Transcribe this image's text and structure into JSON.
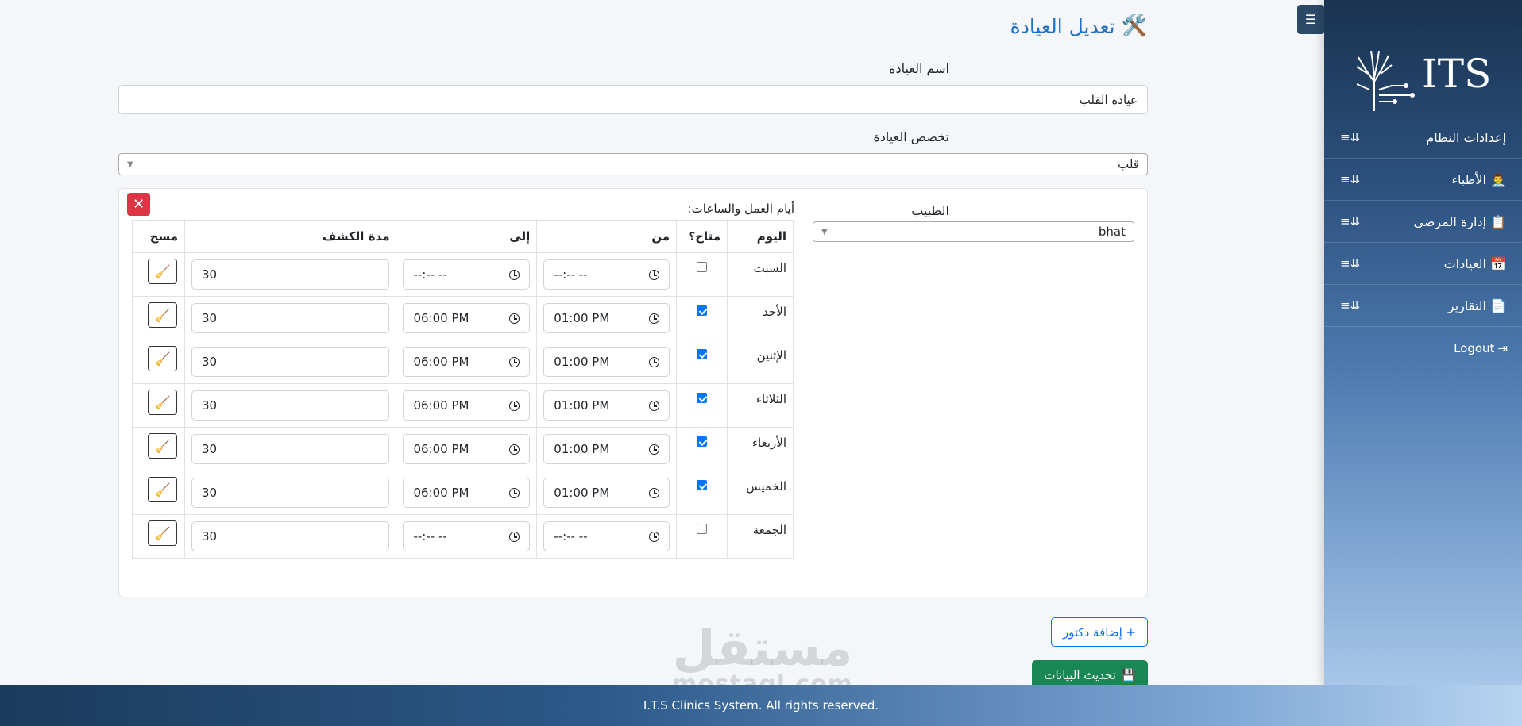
{
  "page": {
    "title": "تعديل العيادة",
    "title_icon": "tools-icon"
  },
  "form": {
    "clinic_name_label": "اسم العيادة",
    "clinic_name_value": "عياده القلب",
    "specialty_label": "تخصص العيادة",
    "specialty_value": "قلب"
  },
  "doctor_block": {
    "doctor_label": "الطبيب",
    "doctor_value": "bhat",
    "schedule_title": "أيام العمل والساعات:",
    "columns": [
      "اليوم",
      "متاح؟",
      "من",
      "إلى",
      "مدة الكشف",
      "مسح"
    ],
    "rows": [
      {
        "day": "السبت",
        "available": false,
        "from": "--:-- --",
        "to": "--:-- --",
        "duration": "30"
      },
      {
        "day": "الأحد",
        "available": true,
        "from": "01:00 PM",
        "to": "06:00 PM",
        "duration": "30"
      },
      {
        "day": "الإثنين",
        "available": true,
        "from": "01:00 PM",
        "to": "06:00 PM",
        "duration": "30"
      },
      {
        "day": "الثلاثاء",
        "available": true,
        "from": "01:00 PM",
        "to": "06:00 PM",
        "duration": "30"
      },
      {
        "day": "الأربعاء",
        "available": true,
        "from": "01:00 PM",
        "to": "06:00 PM",
        "duration": "30"
      },
      {
        "day": "الخميس",
        "available": true,
        "from": "01:00 PM",
        "to": "06:00 PM",
        "duration": "30"
      },
      {
        "day": "الجمعة",
        "available": false,
        "from": "--:-- --",
        "to": "--:-- --",
        "duration": "30"
      }
    ]
  },
  "buttons": {
    "add_doctor": "+ إضافة دكتور",
    "update_data": "تحديث البيانات",
    "remove_doctor": "✕"
  },
  "sidebar": {
    "logo_text": "ITS",
    "items": [
      {
        "label": "إعدادات النظام",
        "icon": ""
      },
      {
        "label": "الأطباء",
        "icon": "👨‍⚕️"
      },
      {
        "label": "إدارة المرضى",
        "icon": "📋"
      },
      {
        "label": "العيادات",
        "icon": "📅"
      },
      {
        "label": "التقارير",
        "icon": "📄"
      }
    ],
    "logout": "Logout"
  },
  "footer": {
    "text": "I.T.S Clinics System. All rights reserved."
  },
  "watermark": {
    "arabic": "مستقل",
    "latin": "mostaql.com"
  },
  "colors": {
    "accent": "#1f6fc5",
    "danger": "#dc3545",
    "success": "#198754",
    "primary": "#0d6efd"
  }
}
